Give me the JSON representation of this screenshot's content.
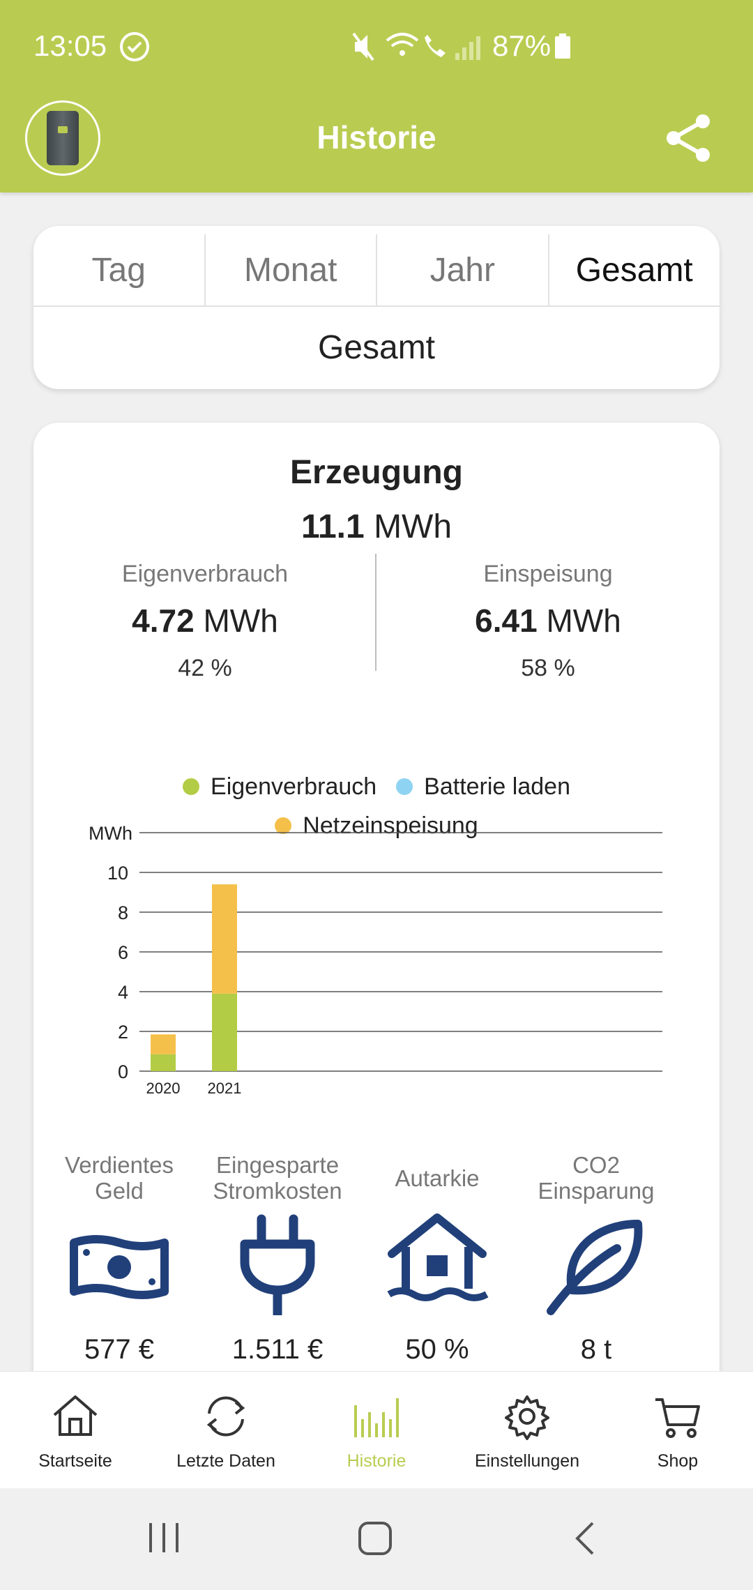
{
  "status_bar": {
    "time": "13:05",
    "battery": "87%"
  },
  "header": {
    "title": "Historie"
  },
  "tabs": [
    {
      "label": "Tag",
      "active": false
    },
    {
      "label": "Monat",
      "active": false
    },
    {
      "label": "Jahr",
      "active": false
    },
    {
      "label": "Gesamt",
      "active": true
    }
  ],
  "period_label": "Gesamt",
  "summary": {
    "title": "Erzeugung",
    "total_value": "11.1",
    "total_unit": "MWh",
    "self_consumption": {
      "label": "Eigenverbrauch",
      "value": "4.72",
      "unit": "MWh",
      "percent": "42 %"
    },
    "feed_in": {
      "label": "Einspeisung",
      "value": "6.41",
      "unit": "MWh",
      "percent": "58 %"
    }
  },
  "colors": {
    "accent": "#b9cc51",
    "eigenverbrauch": "#b3cc45",
    "batterie": "#8fd3f2",
    "netzeinspeisung": "#f5c04a",
    "icon_blue": "#21407a"
  },
  "chart_data": {
    "type": "bar",
    "stacked": true,
    "categories": [
      "2020",
      "2021"
    ],
    "series": [
      {
        "name": "Eigenverbrauch",
        "color": "#b3cc45",
        "values": [
          0.85,
          3.9
        ]
      },
      {
        "name": "Batterie laden",
        "color": "#8fd3f2",
        "values": [
          0,
          0
        ]
      },
      {
        "name": "Netzeinspeisung",
        "color": "#f5c04a",
        "values": [
          1.0,
          5.5
        ]
      }
    ],
    "ylabel": "MWh",
    "yticks": [
      0,
      2,
      4,
      6,
      8,
      10
    ],
    "ylim": [
      0,
      12
    ],
    "grid": true,
    "legend": "top"
  },
  "kpis": [
    {
      "label": "Verdientes Geld",
      "value": "577 €",
      "icon": "money-icon"
    },
    {
      "label": "Eingesparte Stromkosten",
      "value": "1.511 €",
      "icon": "plug-icon"
    },
    {
      "label": "Autarkie",
      "value": "50 %",
      "icon": "house-icon"
    },
    {
      "label": "CO2 Einsparung",
      "value": "8 t",
      "icon": "leaf-icon"
    }
  ],
  "nav": [
    {
      "label": "Startseite",
      "icon": "home-icon"
    },
    {
      "label": "Letzte Daten",
      "icon": "refresh-icon"
    },
    {
      "label": "Historie",
      "icon": "history-icon",
      "active": true
    },
    {
      "label": "Einstellungen",
      "icon": "gear-icon"
    },
    {
      "label": "Shop",
      "icon": "cart-icon"
    }
  ]
}
